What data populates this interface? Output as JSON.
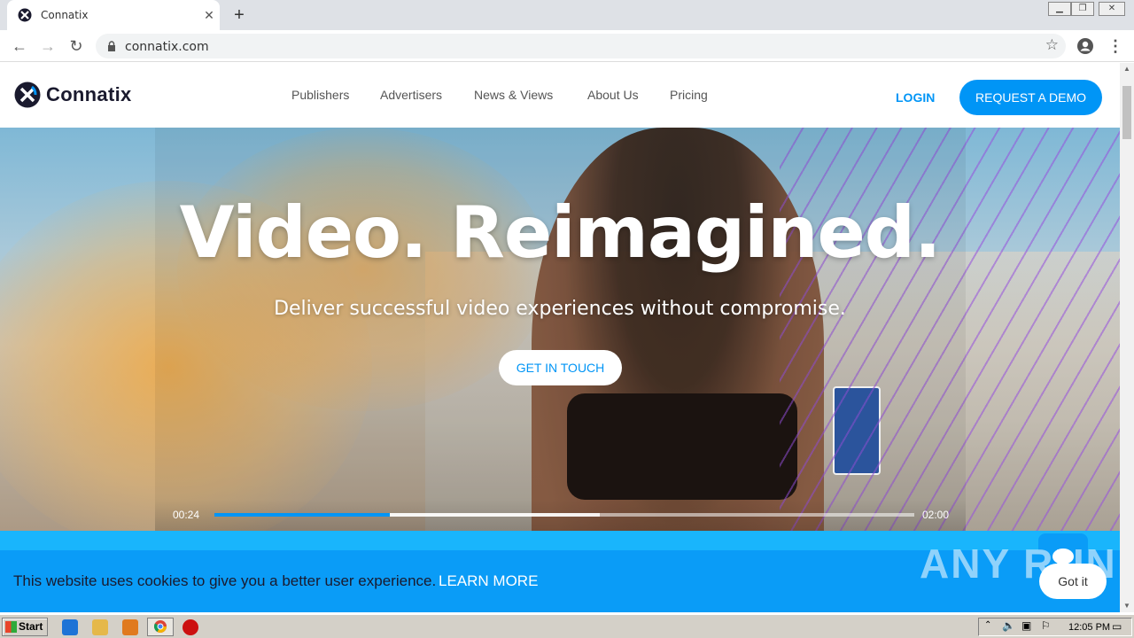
{
  "browser": {
    "tab_title": "Connatix",
    "new_tab_symbol": "+",
    "url": "connatix.com"
  },
  "site": {
    "brand": "Connatix",
    "nav": [
      "Publishers",
      "Advertisers",
      "News & Views",
      "About Us",
      "Pricing"
    ],
    "login": "LOGIN",
    "request_demo": "REQUEST A DEMO",
    "colors": {
      "accent": "#0095f6",
      "cookie_bar": "#0a9cf7"
    }
  },
  "hero": {
    "headline": "Video. Reimagined.",
    "subline": "Deliver successful video experiences without compromise.",
    "cta": "GET IN TOUCH"
  },
  "player": {
    "current_time": "00:24",
    "total_time": "02:00",
    "played_fraction": 0.25,
    "buffered_fraction": 0.55,
    "icons": [
      "previous-icon",
      "pause-icon",
      "next-icon",
      "volume-icon",
      "closed-captions-icon",
      "settings-icon",
      "fullscreen-icon"
    ]
  },
  "cookie": {
    "text": "This website uses cookies to give you a better user experience.",
    "learn_more": "LEARN MORE",
    "accept": "Got it",
    "watermark": "ANY RUN"
  },
  "taskbar": {
    "start": "Start",
    "clock": "12:05 PM"
  }
}
